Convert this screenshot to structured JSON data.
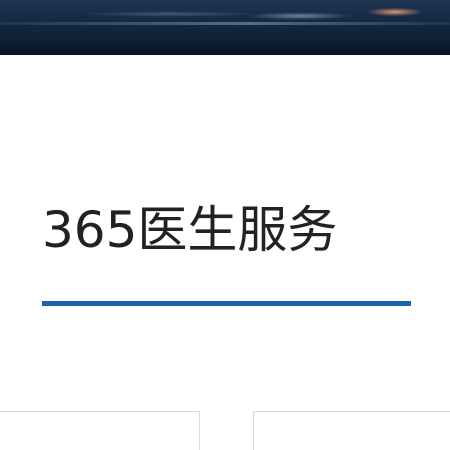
{
  "section": {
    "title": "365医生服务"
  },
  "colors": {
    "title_text": "#222222",
    "underline_accent": "#1a64ae",
    "banner_dark": "#0f2037",
    "card_border": "#d9d9d9"
  },
  "cards": [
    {
      "id": "card-1"
    },
    {
      "id": "card-2"
    }
  ]
}
